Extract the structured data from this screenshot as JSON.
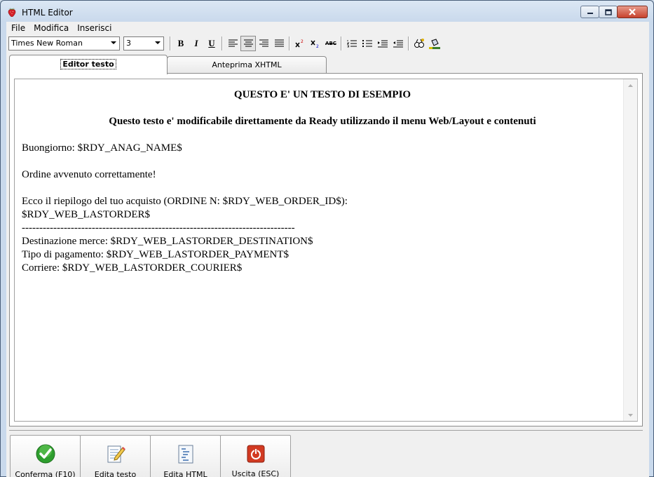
{
  "window": {
    "title": "HTML Editor"
  },
  "menu": [
    "File",
    "Modifica",
    "Inserisci"
  ],
  "toolbar": {
    "font": "Times New Roman",
    "size": "3",
    "bold": "B",
    "italic": "I",
    "underline": "U",
    "strike": "ABC"
  },
  "tabs": {
    "editor": "Editor testo",
    "preview": "Anteprima XHTML"
  },
  "document": {
    "title": "QUESTO E' UN TESTO DI ESEMPIO",
    "subtitle": "Questo testo e' modificabile direttamente da Ready utilizzando il menu Web/Layout e contenuti",
    "greeting": "Buongiorno: $RDY_ANAG_NAME$",
    "confirm": "Ordine avvenuto correttamente!",
    "recap": "Ecco il riepilogo del tuo acquisto (ORDINE N: $RDY_WEB_ORDER_ID$):",
    "lastorder": "$RDY_WEB_LASTORDER$",
    "separator": "------------------------------------------------------------------------------",
    "destination": "Destinazione merce: $RDY_WEB_LASTORDER_DESTINATION$",
    "payment": "Tipo di pagamento: $RDY_WEB_LASTORDER_PAYMENT$",
    "courier": "Corriere: $RDY_WEB_LASTORDER_COURIER$"
  },
  "buttons": {
    "confirm": "Conferma (F10)",
    "edit_text": "Edita testo",
    "edit_html": "Edita HTML",
    "exit": "Uscita (ESC)"
  },
  "colors": {
    "confirm_green": "#2e9e2e",
    "exit_red": "#d23a22"
  }
}
